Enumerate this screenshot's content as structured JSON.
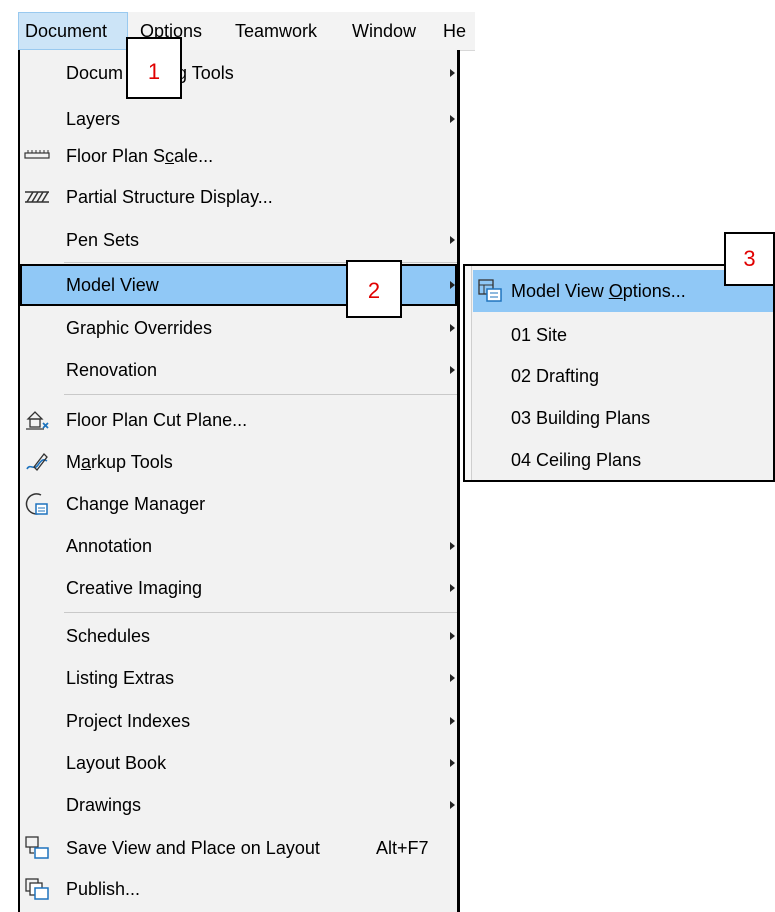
{
  "menubar": {
    "items": [
      "Document",
      "Options",
      "Teamwork",
      "Window",
      "He"
    ]
  },
  "menu": {
    "items": [
      {
        "label": "Documenting Tools",
        "visible_prefix": "Docum",
        "visible_suffix": "g Tools",
        "submenu": true
      },
      {
        "label": "Layers",
        "submenu": true
      },
      {
        "label_pre": "Floor Plan S",
        "label_ul": "c",
        "label_post": "ale...",
        "icon": "scale-ruler-icon"
      },
      {
        "label": "Partial Structure Display...",
        "icon": "hatch-icon"
      },
      {
        "label": "Pen Sets",
        "submenu": true
      },
      {
        "label": "Model View",
        "submenu": true
      },
      {
        "label": "Graphic Overrides",
        "submenu": true
      },
      {
        "label": "Renovation",
        "submenu": true
      },
      {
        "label": "Floor Plan Cut Plane...",
        "icon": "cut-plane-icon"
      },
      {
        "label_pre": "M",
        "label_ul": "a",
        "label_post": "rkup Tools",
        "icon": "markup-pen-icon"
      },
      {
        "label": "Change Manager",
        "icon": "change-manager-icon"
      },
      {
        "label": "Annotation",
        "submenu": true
      },
      {
        "label": "Creative Imaging",
        "submenu": true
      },
      {
        "label": "Schedules",
        "submenu": true
      },
      {
        "label": "Listing Extras",
        "submenu": true
      },
      {
        "label": "Project Indexes",
        "submenu": true
      },
      {
        "label": "Layout Book",
        "submenu": true
      },
      {
        "label": "Drawings",
        "submenu": true
      },
      {
        "label": "Save View and Place on Layout",
        "shortcut": "Alt+F7",
        "icon": "save-view-icon"
      },
      {
        "label": "Publish...",
        "icon": "publish-icon"
      }
    ]
  },
  "submenu": {
    "items": [
      {
        "label_pre": "Model View ",
        "label_ul": "O",
        "label_post": "ptions...",
        "icon": "model-view-options-icon"
      },
      {
        "label": "01 Site"
      },
      {
        "label": "02 Drafting"
      },
      {
        "label": "03 Building Plans"
      },
      {
        "label": "04 Ceiling Plans"
      }
    ]
  },
  "callouts": [
    "1",
    "2",
    "3"
  ],
  "colors": {
    "highlight": "#90c8f6",
    "menu_bg": "#f2f2f2",
    "callout_text": "#e00000",
    "icon_blue": "#1e73be"
  }
}
